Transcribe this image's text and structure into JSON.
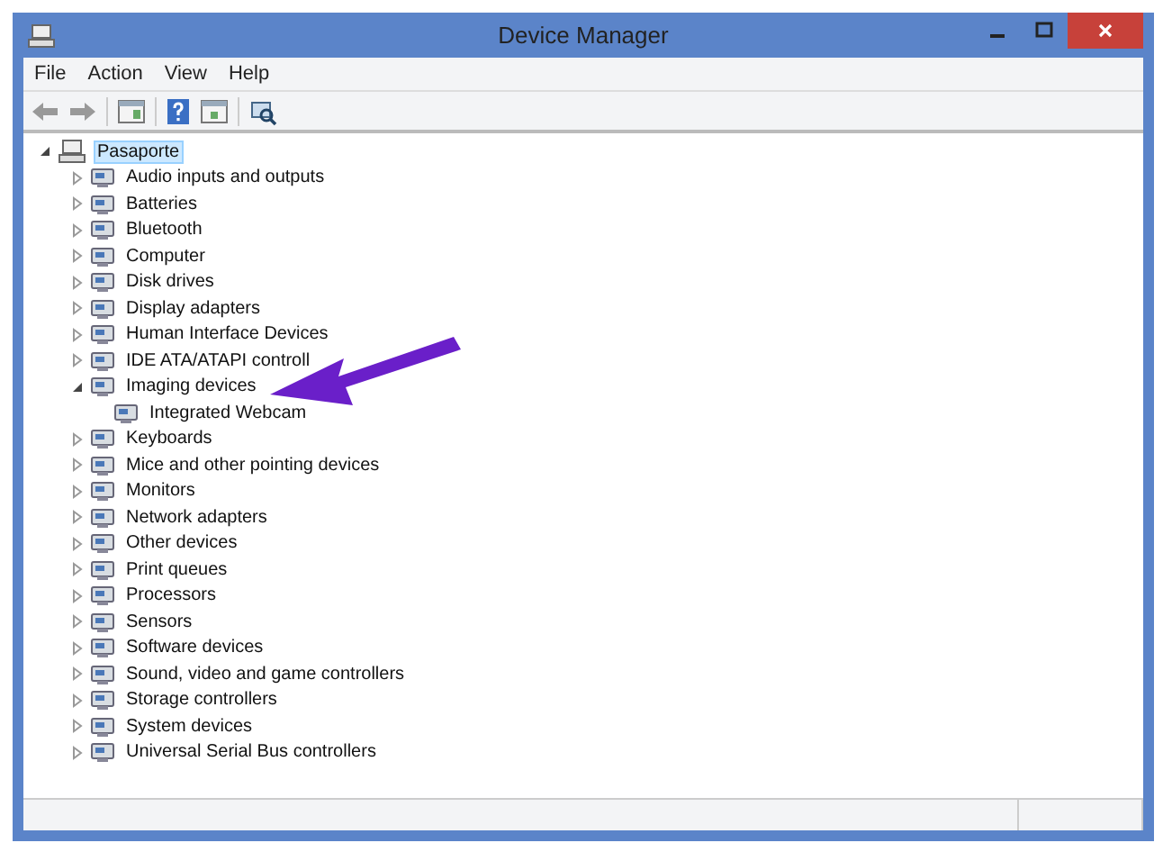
{
  "window": {
    "title": "Device Manager"
  },
  "menu": [
    "File",
    "Action",
    "View",
    "Help"
  ],
  "tree": {
    "label": "Pasaporte",
    "expanded": true,
    "selected": true,
    "children": [
      {
        "label": "Audio inputs and outputs",
        "expanded": false
      },
      {
        "label": "Batteries",
        "expanded": false
      },
      {
        "label": "Bluetooth",
        "expanded": false
      },
      {
        "label": "Computer",
        "expanded": false
      },
      {
        "label": "Disk drives",
        "expanded": false
      },
      {
        "label": "Display adapters",
        "expanded": false
      },
      {
        "label": "Human Interface Devices",
        "expanded": false
      },
      {
        "label": "IDE ATA/ATAPI controll",
        "expanded": false
      },
      {
        "label": "Imaging devices",
        "expanded": true,
        "children": [
          {
            "label": "Integrated Webcam"
          }
        ]
      },
      {
        "label": "Keyboards",
        "expanded": false
      },
      {
        "label": "Mice and other pointing devices",
        "expanded": false
      },
      {
        "label": "Monitors",
        "expanded": false
      },
      {
        "label": "Network adapters",
        "expanded": false
      },
      {
        "label": "Other devices",
        "expanded": false
      },
      {
        "label": "Print queues",
        "expanded": false
      },
      {
        "label": "Processors",
        "expanded": false
      },
      {
        "label": "Sensors",
        "expanded": false
      },
      {
        "label": "Software devices",
        "expanded": false
      },
      {
        "label": "Sound, video and game controllers",
        "expanded": false
      },
      {
        "label": "Storage controllers",
        "expanded": false
      },
      {
        "label": "System devices",
        "expanded": false
      },
      {
        "label": "Universal Serial Bus controllers",
        "expanded": false
      }
    ]
  }
}
